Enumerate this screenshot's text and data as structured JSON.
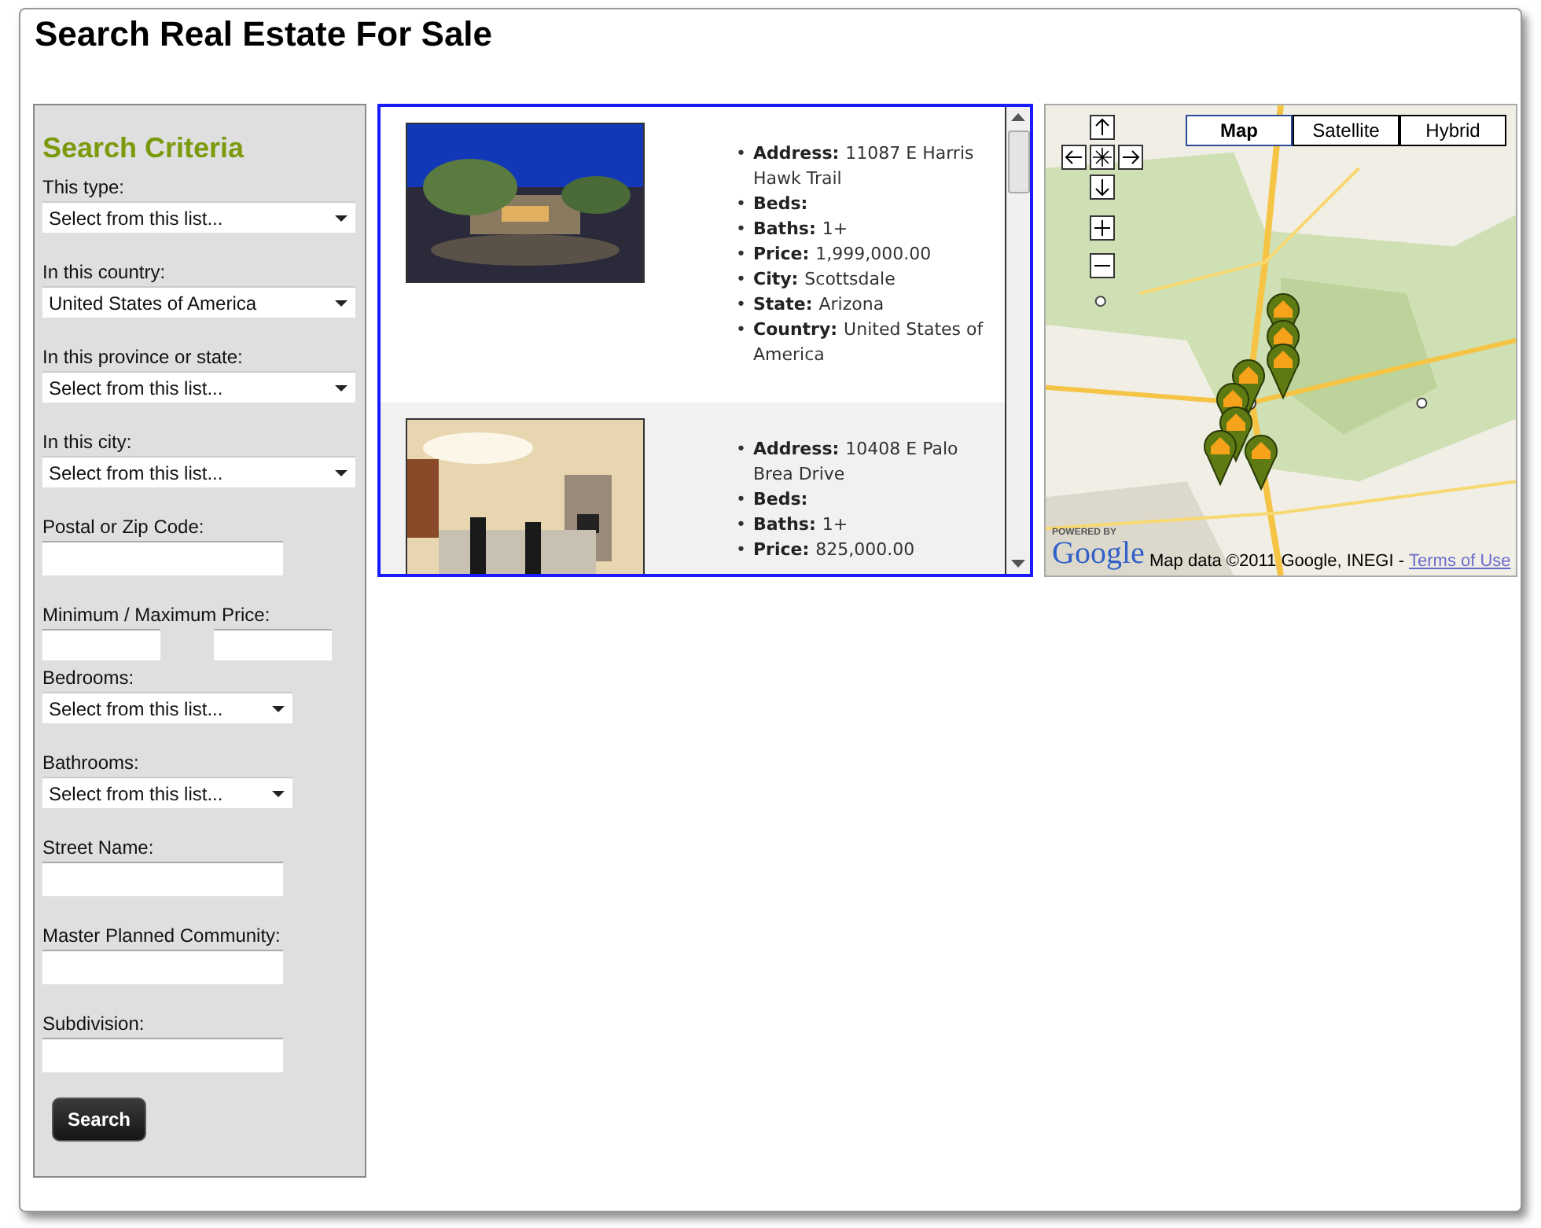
{
  "page": {
    "title": "Search Real Estate For Sale"
  },
  "sidebar": {
    "title": "Search Criteria",
    "fields": [
      {
        "kind": "select",
        "label": "This type:",
        "value": "Select from this list..."
      },
      {
        "kind": "select",
        "label": "In this country:",
        "value": "United States of America"
      },
      {
        "kind": "select",
        "label": "In this province or state:",
        "value": "Select from this list..."
      },
      {
        "kind": "select",
        "label": "In this city:",
        "value": "Select from this list..."
      },
      {
        "kind": "text",
        "label": "Postal or Zip Code:"
      },
      {
        "kind": "range",
        "label": "Minimum / Maximum Price:"
      },
      {
        "kind": "short_select",
        "label": "Bedrooms:",
        "value": "Select from this list..."
      },
      {
        "kind": "short_select",
        "label": "Bathrooms:",
        "value": "Select from this list..."
      },
      {
        "kind": "text",
        "label": "Street Name:"
      },
      {
        "kind": "text",
        "label": "Master Planned Community:"
      },
      {
        "kind": "text",
        "label": "Subdivision:"
      }
    ],
    "button": "Search"
  },
  "listings": [
    {
      "details": [
        {
          "bullet": "•",
          "label": "Address:",
          "value": "11087 E Harris Hawk Trail"
        },
        {
          "bullet": "•",
          "label": "Beds:"
        },
        {
          "bullet": "•",
          "label": "Baths:",
          "value": "1+"
        },
        {
          "bullet": "•",
          "label": "Price:",
          "value": "1,999,000.00"
        },
        {
          "bullet": "•",
          "label": "City:",
          "value": "Scottsdale"
        },
        {
          "bullet": "•",
          "label": "State:",
          "value": "Arizona"
        },
        {
          "bullet": "•",
          "label": "Country:",
          "value": "United States of America"
        }
      ]
    },
    {
      "details": [
        {
          "bullet": "•",
          "label": "Address:",
          "value": "10408 E Palo Brea Drive"
        },
        {
          "bullet": "•",
          "label": "Beds:"
        },
        {
          "bullet": "•",
          "label": "Baths:",
          "value": "1+"
        },
        {
          "bullet": "•",
          "label": "Price:",
          "value": "825,000.00"
        }
      ]
    }
  ],
  "map": {
    "map_types": [
      {
        "label": "Map",
        "selected": true
      },
      {
        "label": "Satellite",
        "selected": false
      },
      {
        "label": "Hybrid",
        "selected": false
      }
    ],
    "powered_by": "POWERED BY",
    "logo": "Google",
    "attribution": "Map data ©2011 Google, INEGI -",
    "terms_link": "Terms of Use"
  }
}
